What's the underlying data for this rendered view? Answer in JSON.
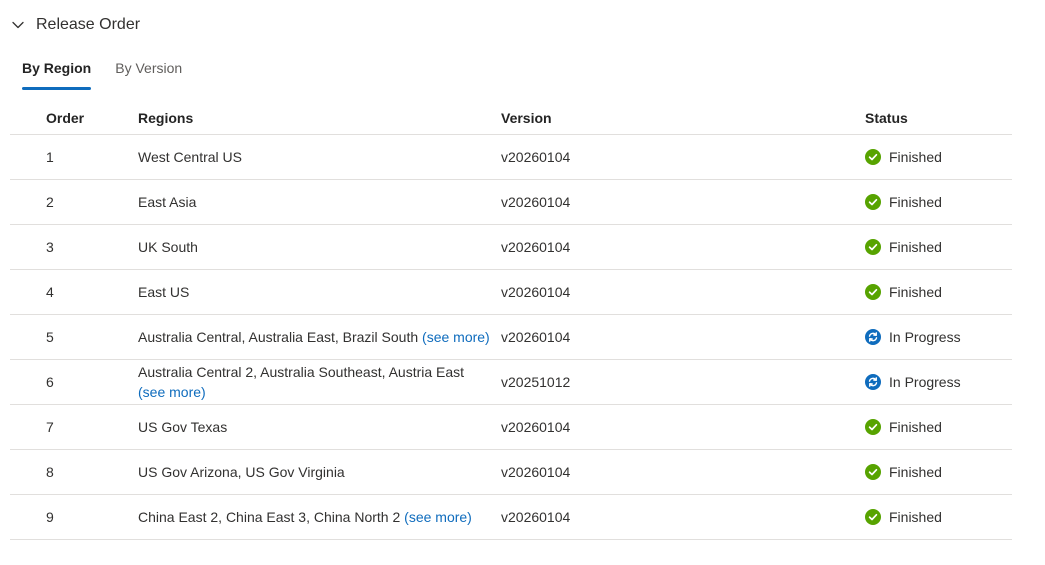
{
  "section": {
    "title": "Release Order",
    "expand_icon": "chevron-down-icon"
  },
  "tabs": [
    {
      "label": "By Region",
      "active": true
    },
    {
      "label": "By Version",
      "active": false
    }
  ],
  "table": {
    "headers": {
      "order": "Order",
      "regions": "Regions",
      "version": "Version",
      "status": "Status"
    },
    "see_more_label": "(see more)",
    "rows": [
      {
        "order": "1",
        "regions": "West Central US",
        "see_more": false,
        "version": "v20260104",
        "status": "Finished",
        "icon": "check-circle-icon"
      },
      {
        "order": "2",
        "regions": "East Asia",
        "see_more": false,
        "version": "v20260104",
        "status": "Finished",
        "icon": "check-circle-icon"
      },
      {
        "order": "3",
        "regions": "UK South",
        "see_more": false,
        "version": "v20260104",
        "status": "Finished",
        "icon": "check-circle-icon"
      },
      {
        "order": "4",
        "regions": "East US",
        "see_more": false,
        "version": "v20260104",
        "status": "Finished",
        "icon": "check-circle-icon"
      },
      {
        "order": "5",
        "regions": "Australia Central, Australia East, Brazil South",
        "see_more": true,
        "version": "v20260104",
        "status": "In Progress",
        "icon": "sync-icon"
      },
      {
        "order": "6",
        "regions": "Australia Central 2, Australia Southeast, Austria East",
        "see_more": true,
        "version": "v20251012",
        "status": "In Progress",
        "icon": "sync-icon"
      },
      {
        "order": "7",
        "regions": "US Gov Texas",
        "see_more": false,
        "version": "v20260104",
        "status": "Finished",
        "icon": "check-circle-icon"
      },
      {
        "order": "8",
        "regions": "US Gov Arizona, US Gov Virginia",
        "see_more": false,
        "version": "v20260104",
        "status": "Finished",
        "icon": "check-circle-icon"
      },
      {
        "order": "9",
        "regions": "China East 2, China East 3, China North 2",
        "see_more": true,
        "version": "v20260104",
        "status": "Finished",
        "icon": "check-circle-icon"
      }
    ]
  },
  "colors": {
    "finished": "#57a300",
    "in_progress": "#0f6cbd",
    "link": "#0f6cbd",
    "tab_underline": "#0f6cbd"
  }
}
